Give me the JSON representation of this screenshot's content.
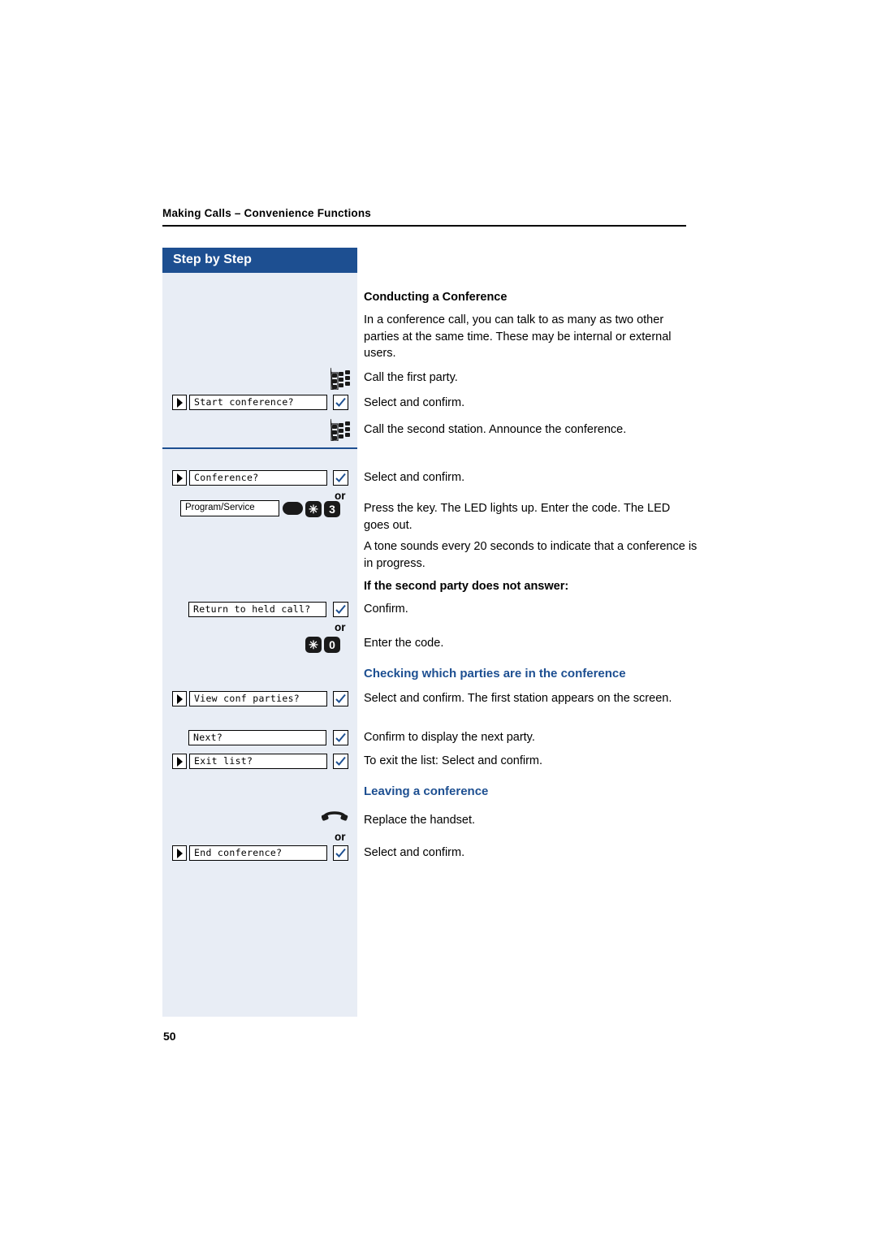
{
  "header": {
    "breadcrumb": "Making Calls – Convenience Functions",
    "step_by_step": "Step by Step"
  },
  "page_number": "50",
  "title": "Conducting a Conference",
  "intro": "In a conference call, you can talk to as many as two other parties at the same time. These may be internal or external users.",
  "steps": [
    {
      "id": "call-first-party",
      "icon": "keypad-icon",
      "text": "Call the first party."
    },
    {
      "id": "start-conference",
      "softkey": "Start conference?",
      "text": "Select and confirm."
    },
    {
      "id": "call-second-station",
      "icon": "keypad-icon",
      "text": "Call the second station. Announce the conference."
    },
    {
      "id": "conference",
      "softkey": "Conference?",
      "text": "Select and confirm."
    },
    {
      "id": "program-service",
      "key_label": "Program/Service",
      "code_keys": [
        "✳",
        "3"
      ],
      "or": "or",
      "text": "Press the key. The LED lights up. Enter the code. The LED goes out."
    },
    {
      "id": "tone-note",
      "text": "A tone sounds every 20 seconds to indicate that a conference is in progress."
    }
  ],
  "no_answer": {
    "heading": "If the second party does not answer:",
    "return_softkey": "Return to held call?",
    "confirm_text": "Confirm.",
    "or": "or",
    "code_keys": [
      "✳",
      "0"
    ],
    "code_text": "Enter the code."
  },
  "checking": {
    "heading": "Checking which parties are in the conference",
    "view_softkey": "View conf parties?",
    "view_text": "Select and confirm. The first station appears on the screen.",
    "next_softkey": "Next?",
    "next_text": "Confirm to display the next party.",
    "exit_softkey": "Exit list?",
    "exit_text": "To exit the list: Select and confirm."
  },
  "leaving": {
    "heading": "Leaving a conference",
    "handset_text": "Replace the handset.",
    "or": "or",
    "end_softkey": "End conference?",
    "end_text": "Select and confirm."
  },
  "colors": {
    "accent_blue": "#1d4f91",
    "panel_blue": "#e8edf5"
  }
}
